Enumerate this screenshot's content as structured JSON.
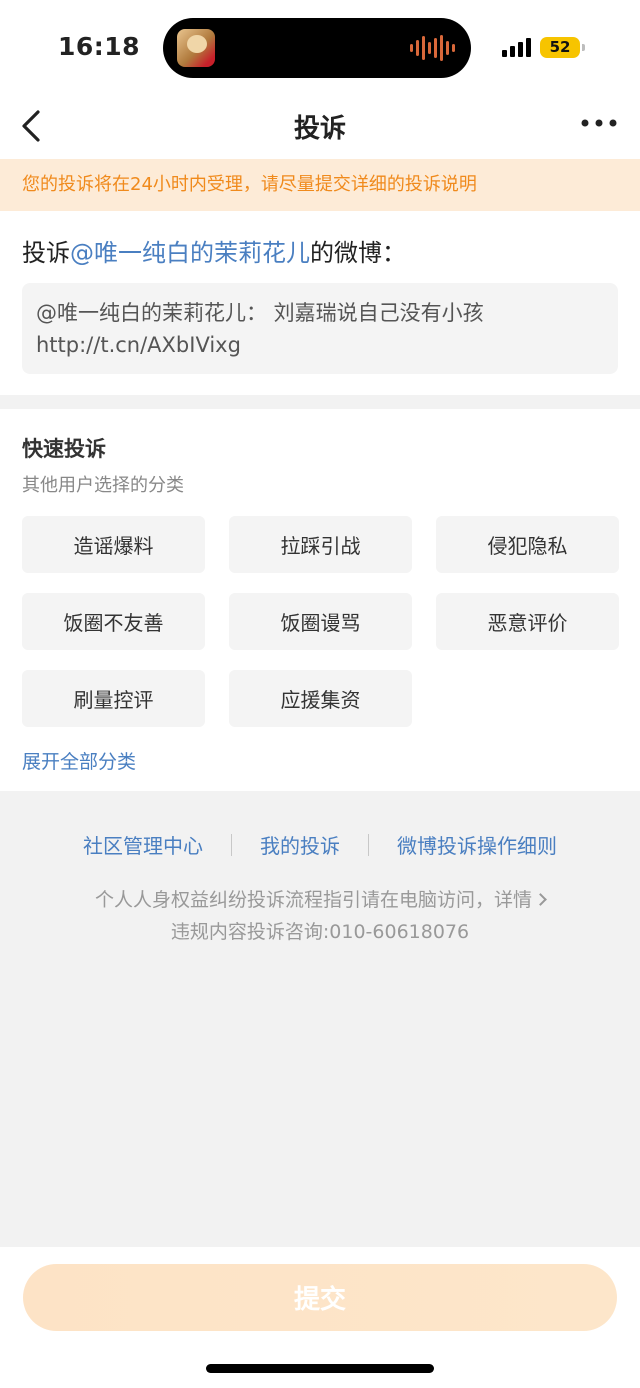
{
  "status_bar": {
    "time": "16:18",
    "battery": "52",
    "battery_color": "#f7c400"
  },
  "nav": {
    "back_icon": "chevron-left-icon",
    "title": "投诉",
    "more_icon": "more-dots-icon"
  },
  "notice": {
    "text": "您的投诉将在24小时内受理，请尽量提交详细的投诉说明",
    "color": "#f08a1c",
    "background": "#fdebd7"
  },
  "target": {
    "prefix": "投诉",
    "user": "@唯一纯白的茉莉花儿",
    "suffix": "的微博：",
    "quote_line1": "@唯一纯白的茉莉花儿： 刘嘉瑞说自己没有小孩",
    "quote_line2": "http://t.cn/AXbIVixg"
  },
  "quick": {
    "title": "快速投诉",
    "subtitle": "其他用户选择的分类",
    "categories": [
      "造谣爆料",
      "拉踩引战",
      "侵犯隐私",
      "饭圈不友善",
      "饭圈谩骂",
      "恶意评价",
      "刷量控评",
      "应援集资"
    ],
    "expand_label": "展开全部分类"
  },
  "footer": {
    "links": [
      "社区管理中心",
      "我的投诉",
      "微博投诉操作细则"
    ],
    "info_line1": "个人人身权益纠纷投诉流程指引请在电脑访问，详情",
    "info_line2": "违规内容投诉咨询:010-60618076"
  },
  "submit": {
    "label": "提交"
  },
  "colors": {
    "link": "#4a7fc1",
    "accent": "#f08a1c"
  }
}
